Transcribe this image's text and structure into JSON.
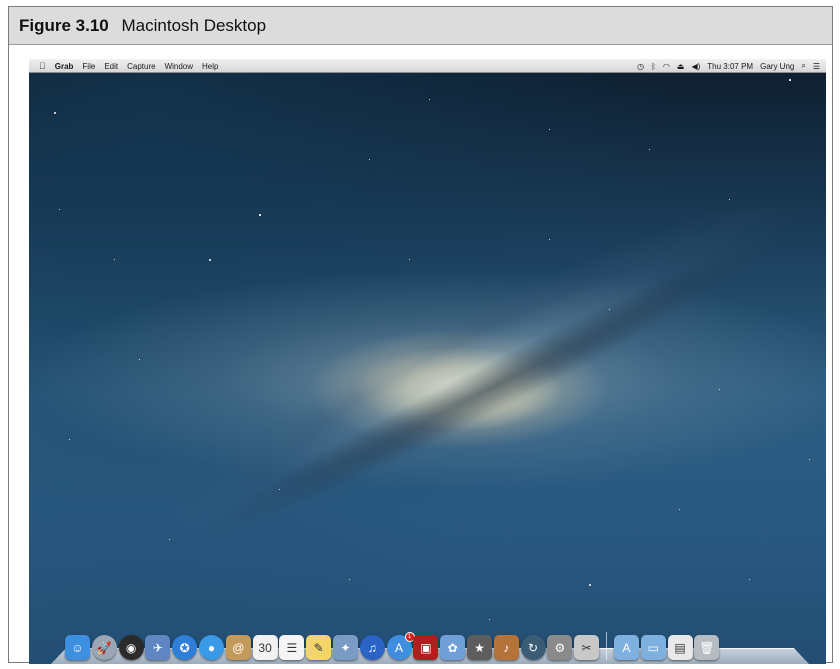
{
  "caption": {
    "number": "Figure 3.10",
    "title": "Macintosh Desktop"
  },
  "menubar": {
    "apple_icon": "apple-logo-icon",
    "app_name": "Grab",
    "menus": [
      "File",
      "Edit",
      "Capture",
      "Window",
      "Help"
    ],
    "status_icons": [
      "time-machine-icon",
      "bluetooth-icon",
      "wifi-icon",
      "eject-icon",
      "volume-icon"
    ],
    "clock": "Thu 3:07 PM",
    "user": "Gary Ung",
    "spotlight_icon": "spotlight-search-icon",
    "notifications_icon": "notification-center-icon"
  },
  "dock": {
    "apps": [
      {
        "name": "finder-icon",
        "color": "#3d8fe0",
        "glyph": "☺"
      },
      {
        "name": "launchpad-icon",
        "color": "#9aa6b4",
        "glyph": "🚀"
      },
      {
        "name": "mission-control-icon",
        "color": "#2b2b2b",
        "glyph": "◉"
      },
      {
        "name": "mail-stamp-icon",
        "color": "#5f86c2",
        "glyph": "✈"
      },
      {
        "name": "safari-icon",
        "color": "#2f7fd9",
        "glyph": "✪"
      },
      {
        "name": "messages-icon",
        "color": "#3b9ae8",
        "glyph": "●"
      },
      {
        "name": "contacts-icon",
        "color": "#c49a5a",
        "glyph": "@"
      },
      {
        "name": "calendar-icon",
        "color": "#f2f2f2",
        "glyph": "30"
      },
      {
        "name": "reminders-icon",
        "color": "#f5f5f5",
        "glyph": "☰"
      },
      {
        "name": "notes-icon",
        "color": "#f3d56a",
        "glyph": "✎"
      },
      {
        "name": "preview-icon",
        "color": "#7a9bc4",
        "glyph": "✦"
      },
      {
        "name": "itunes-icon",
        "color": "#2b63c7",
        "glyph": "♫"
      },
      {
        "name": "app-store-icon",
        "color": "#3f8ee0",
        "glyph": "A"
      },
      {
        "name": "photo-booth-icon",
        "color": "#b21d1d",
        "glyph": "▣"
      },
      {
        "name": "iphoto-icon",
        "color": "#6f9fd6",
        "glyph": "✿"
      },
      {
        "name": "imovie-icon",
        "color": "#5d5d5d",
        "glyph": "★"
      },
      {
        "name": "garageband-icon",
        "color": "#b5733a",
        "glyph": "♪"
      },
      {
        "name": "time-machine-icon",
        "color": "#3a5d75",
        "glyph": "↻"
      },
      {
        "name": "system-preferences-icon",
        "color": "#8a8a8a",
        "glyph": "⚙"
      },
      {
        "name": "grab-icon",
        "color": "#c8c8c8",
        "glyph": "✂"
      }
    ],
    "stacks": [
      {
        "name": "applications-folder-icon",
        "color": "#7fb1e0",
        "glyph": "A"
      },
      {
        "name": "documents-folder-icon",
        "color": "#7fb1e0",
        "glyph": "▭"
      },
      {
        "name": "downloads-stack-icon",
        "color": "#e9e9e9",
        "glyph": "▤"
      },
      {
        "name": "trash-icon",
        "color": "#b7bcc2",
        "glyph": "🗑"
      }
    ],
    "badge_app": "app-store-icon",
    "badge_text": "1"
  }
}
